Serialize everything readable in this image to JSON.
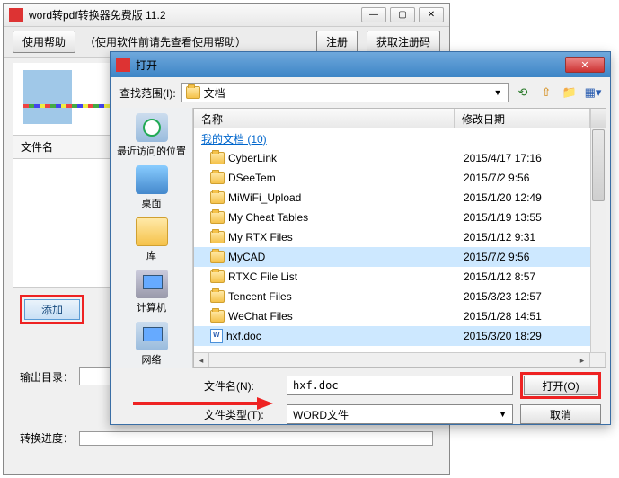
{
  "main": {
    "title": "word转pdf转换器免费版 11.2",
    "help_btn": "使用帮助",
    "help_note": "（使用软件前请先查看使用帮助）",
    "register_btn": "注册",
    "getcode_btn": "获取注册码",
    "filename_header": "文件名",
    "add_btn": "添加",
    "outdir_label": "输出目录：",
    "progress_label": "转换进度："
  },
  "dialog": {
    "title": "打开",
    "lookin_label": "查找范围(I):",
    "lookin_value": "文档",
    "sidebar": {
      "recent": "最近访问的位置",
      "desktop": "桌面",
      "library": "库",
      "computer": "计算机",
      "network": "网络"
    },
    "header_name": "名称",
    "header_date": "修改日期",
    "mydocs": "我的文档 (10)",
    "rows": [
      {
        "name": "CyberLink",
        "date": "2015/4/17 17:16"
      },
      {
        "name": "DSeeTem",
        "date": "2015/7/2 9:56"
      },
      {
        "name": "MiWiFi_Upload",
        "date": "2015/1/20 12:49"
      },
      {
        "name": "My Cheat Tables",
        "date": "2015/1/19 13:55"
      },
      {
        "name": "My RTX Files",
        "date": "2015/1/12 9:31"
      },
      {
        "name": "MyCAD",
        "date": "2015/7/2 9:56"
      },
      {
        "name": "RTXC File List",
        "date": "2015/1/12 8:57"
      },
      {
        "name": "Tencent Files",
        "date": "2015/3/23 12:57"
      },
      {
        "name": "WeChat Files",
        "date": "2015/1/28 14:51"
      },
      {
        "name": "hxf.doc",
        "date": "2015/3/20 18:29"
      }
    ],
    "filename_label": "文件名(N):",
    "filename_value": "hxf.doc",
    "filetype_label": "文件类型(T):",
    "filetype_value": "WORD文件",
    "open_btn": "打开(O)",
    "cancel_btn": "取消"
  }
}
